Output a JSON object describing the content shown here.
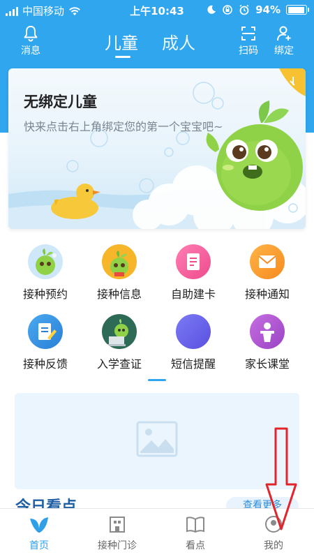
{
  "status_bar": {
    "carrier": "中国移动",
    "time": "上午10:43",
    "battery": "94%",
    "battery_level": 0.94
  },
  "header": {
    "message_label": "消息",
    "tabs": [
      {
        "label": "儿童",
        "active": true
      },
      {
        "label": "成人",
        "active": false
      }
    ],
    "scan_label": "扫码",
    "bind_label": "绑定"
  },
  "banner": {
    "title": "无绑定儿童",
    "subtitle": "快来点击右上角绑定您的第一个宝宝吧~"
  },
  "menu": {
    "items": [
      {
        "label": "接种预约",
        "icon": "sprout-mascot-icon"
      },
      {
        "label": "接种信息",
        "icon": "sprout-mascot-icon"
      },
      {
        "label": "自助建卡",
        "icon": "card-icon"
      },
      {
        "label": "接种通知",
        "icon": "envelope-icon"
      },
      {
        "label": "接种反馈",
        "icon": "feedback-icon"
      },
      {
        "label": "入学查证",
        "icon": "sprout-laptop-icon"
      },
      {
        "label": "短信提醒",
        "icon": "sms-icon"
      },
      {
        "label": "家长课堂",
        "icon": "lectern-icon"
      }
    ]
  },
  "content": {
    "news_title": "今日看点",
    "see_more": "查看更多"
  },
  "tabbar": {
    "items": [
      {
        "label": "首页",
        "icon": "home-sprout-icon",
        "active": true
      },
      {
        "label": "接种门诊",
        "icon": "clinic-building-icon",
        "active": false
      },
      {
        "label": "看点",
        "icon": "book-icon",
        "active": false
      },
      {
        "label": "我的",
        "icon": "profile-icon",
        "active": false
      }
    ]
  },
  "colors": {
    "primary": "#2fa6ee",
    "tab_active": "#2f9fe8",
    "annotation": "#e0262c"
  }
}
